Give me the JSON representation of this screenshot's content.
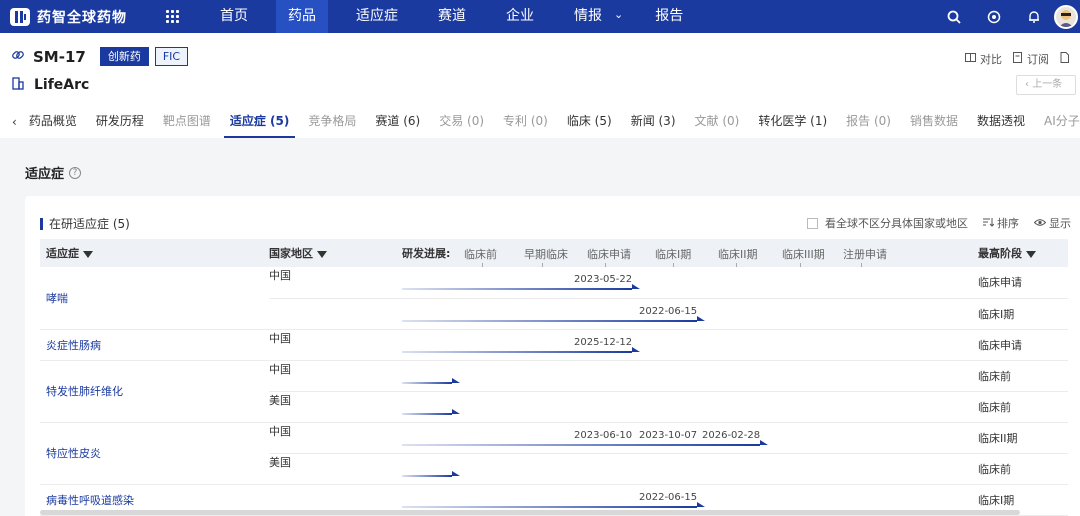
{
  "nav": {
    "logo": "药智全球药物",
    "items": [
      "首页",
      "药品",
      "适应症",
      "赛道",
      "企业",
      "情报",
      "报告"
    ],
    "active_index": 1,
    "dropdown_item": "情报",
    "accent": "#1a3aa0"
  },
  "drug": {
    "name": "SM-17",
    "badge_innovative": "创新药",
    "badge_fic": "FIC",
    "company": "LifeArc"
  },
  "actions": {
    "compare": "对比",
    "subscribe": "订阅",
    "prev": "上一条"
  },
  "tabs": [
    {
      "label": "药品概览",
      "state": "normal"
    },
    {
      "label": "研发历程",
      "state": "normal"
    },
    {
      "label": "靶点图谱",
      "state": "disabled"
    },
    {
      "label": "适应症 (5)",
      "state": "active"
    },
    {
      "label": "竞争格局",
      "state": "disabled"
    },
    {
      "label": "赛道 (6)",
      "state": "normal"
    },
    {
      "label": "交易 (0)",
      "state": "disabled"
    },
    {
      "label": "专利 (0)",
      "state": "disabled"
    },
    {
      "label": "临床 (5)",
      "state": "normal"
    },
    {
      "label": "新闻 (3)",
      "state": "normal"
    },
    {
      "label": "文献 (0)",
      "state": "disabled"
    },
    {
      "label": "转化医学 (1)",
      "state": "normal"
    },
    {
      "label": "报告 (0)",
      "state": "disabled"
    },
    {
      "label": "销售数据",
      "state": "disabled"
    },
    {
      "label": "数据透视",
      "state": "normal"
    },
    {
      "label": "AI分子对",
      "state": "disabled"
    }
  ],
  "section": {
    "title": "适应症",
    "card_title": "在研适应症 (5)",
    "global_checkbox": "看全球不区分具体国家或地区",
    "sort": "排序",
    "display": "显示"
  },
  "table": {
    "headers": {
      "indication": "适应症",
      "region": "国家地区",
      "progress": "研发进展:",
      "highest": "最高阶段"
    },
    "stages": [
      "临床前",
      "早期临床",
      "临床申请",
      "临床I期",
      "临床II期",
      "临床III期",
      "注册申请"
    ],
    "rows": [
      {
        "indication": "哮喘",
        "region": "中国",
        "stage_index": 2,
        "dates": [
          "2023-05-22"
        ],
        "highest": "临床申请",
        "group_start": true,
        "group_span": 2
      },
      {
        "indication": "",
        "region": "",
        "stage_index": 3,
        "dates": [
          "2022-06-15"
        ],
        "highest": "临床I期",
        "group_start": false
      },
      {
        "indication": "炎症性肠病",
        "region": "中国",
        "stage_index": 2,
        "dates": [
          "2025-12-12"
        ],
        "highest": "临床申请",
        "group_start": true,
        "group_span": 1
      },
      {
        "indication": "特发性肺纤维化",
        "region": "中国",
        "stage_index": 0,
        "dates": [],
        "highest": "临床前",
        "group_start": true,
        "group_span": 2
      },
      {
        "indication": "",
        "region": "美国",
        "stage_index": 0,
        "dates": [],
        "highest": "临床前",
        "group_start": false
      },
      {
        "indication": "特应性皮炎",
        "region": "中国",
        "stage_index": 4,
        "dates": [
          "2023-06-10",
          "2023-10-07",
          "2026-02-28"
        ],
        "highest": "临床II期",
        "group_start": true,
        "group_span": 2
      },
      {
        "indication": "",
        "region": "美国",
        "stage_index": 0,
        "dates": [],
        "highest": "临床前",
        "group_start": false
      },
      {
        "indication": "病毒性呼吸道感染",
        "region": "",
        "stage_index": 3,
        "dates": [
          "2022-06-15"
        ],
        "highest": "临床I期",
        "group_start": true,
        "group_span": 1
      }
    ]
  }
}
